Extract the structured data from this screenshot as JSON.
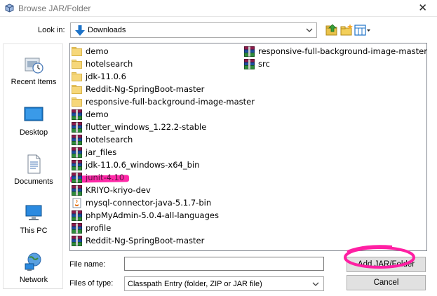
{
  "window": {
    "title": "Browse JAR/Folder",
    "close_glyph": "✕"
  },
  "toolbar": {
    "look_in_label": "Look in:",
    "look_in_value": "Downloads",
    "up_icon": "up-folder-icon",
    "new_folder_icon": "new-folder-icon",
    "view_icon": "view-menu-icon"
  },
  "places": [
    {
      "label": "Recent Items",
      "icon": "recent-items-icon"
    },
    {
      "label": "Desktop",
      "icon": "desktop-icon"
    },
    {
      "label": "Documents",
      "icon": "documents-icon"
    },
    {
      "label": "This PC",
      "icon": "this-pc-icon"
    },
    {
      "label": "Network",
      "icon": "network-icon"
    }
  ],
  "files": {
    "column1": [
      {
        "name": "demo",
        "type": "folder"
      },
      {
        "name": "hotelsearch",
        "type": "folder"
      },
      {
        "name": "jdk-11.0.6",
        "type": "folder"
      },
      {
        "name": "Reddit-Ng-SpringBoot-master",
        "type": "folder"
      },
      {
        "name": "responsive-full-background-image-master",
        "type": "folder"
      },
      {
        "name": "demo",
        "type": "archive"
      },
      {
        "name": "flutter_windows_1.22.2-stable",
        "type": "archive"
      },
      {
        "name": "hotelsearch",
        "type": "archive"
      },
      {
        "name": "jar_files",
        "type": "archive"
      },
      {
        "name": "jdk-11.0.6_windows-x64_bin",
        "type": "archive"
      },
      {
        "name": "junit-4.10",
        "type": "archive",
        "highlighted": true
      },
      {
        "name": "KRIYO-kriyo-dev",
        "type": "archive"
      },
      {
        "name": "mysql-connector-java-5.1.7-bin",
        "type": "jar"
      },
      {
        "name": "phpMyAdmin-5.0.4-all-languages",
        "type": "archive"
      },
      {
        "name": "profile",
        "type": "archive"
      },
      {
        "name": "Reddit-Ng-SpringBoot-master",
        "type": "archive"
      }
    ],
    "column2": [
      {
        "name": "responsive-full-background-image-master",
        "type": "archive"
      },
      {
        "name": "src",
        "type": "archive"
      }
    ]
  },
  "form": {
    "file_name_label": "File name:",
    "file_name_value": "",
    "files_of_type_label": "Files of type:",
    "files_of_type_value": "Classpath Entry (folder, ZIP or JAR file)"
  },
  "buttons": {
    "add": "Add JAR/Folder",
    "cancel": "Cancel"
  },
  "colors": {
    "highlight": "#ff1fa3",
    "folder": "#f6d77a",
    "accent": "#1e73c8"
  }
}
